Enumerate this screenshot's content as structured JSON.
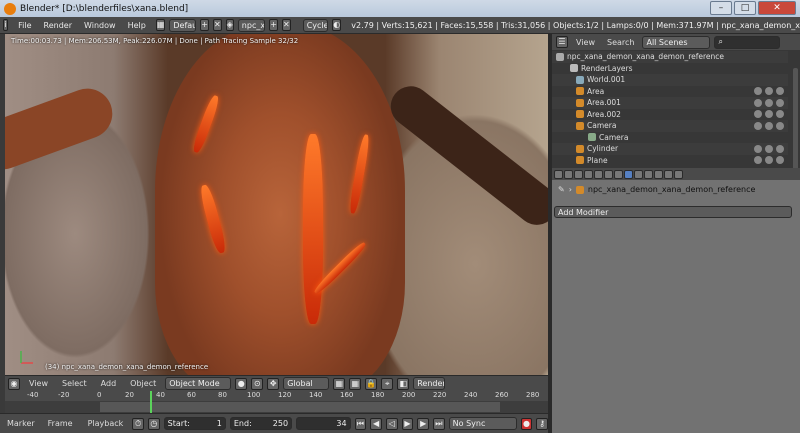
{
  "window": {
    "title": "Blender* [D:\\blenderfiles\\xana.blend]",
    "min": "–",
    "max": "□",
    "close": "✕"
  },
  "info": {
    "menus": [
      "File",
      "Render",
      "Window",
      "Help"
    ],
    "screen_layout": "Default",
    "scene": "npc_xana_demon_x...",
    "engine": "Cycles Render",
    "stats": "v2.79 | Verts:15,621 | Faces:15,558 | Tris:31,056 | Objects:1/2 | Lamps:0/0 | Mem:371.97M | npc_xana_demon_x"
  },
  "viewport": {
    "render_info": "Time:00:03.73 | Mem:206.53M, Peak:226.07M | Done | Path Tracing Sample 32/32",
    "object_label": "(34) npc_xana_demon_xana_demon_reference",
    "menus": [
      "View",
      "Select",
      "Add",
      "Object"
    ],
    "mode": "Object Mode",
    "orientation": "Global",
    "render_layer": "RenderLay"
  },
  "timeline": {
    "ticks": [
      "-40",
      "-20",
      "0",
      "20",
      "40",
      "60",
      "80",
      "100",
      "120",
      "140",
      "160",
      "180",
      "200",
      "220",
      "240",
      "260",
      "280"
    ],
    "current_frame": "34",
    "menus": [
      "Marker",
      "Frame",
      "Playback"
    ],
    "start_label": "Start:",
    "start": "1",
    "end_label": "End:",
    "end": "250",
    "sync": "No Sync"
  },
  "outliner": {
    "view": "View",
    "search": "Search",
    "filter": "All Scenes",
    "rows": [
      "npc_xana_demon_xana_demon_reference",
      "RenderLayers",
      "World.001",
      "Area",
      "Area.001",
      "Area.002",
      "Camera",
      "Camera",
      "Cylinder",
      "Plane"
    ]
  },
  "properties": {
    "object": "npc_xana_demon_xana_demon_reference",
    "add_modifier": "Add Modifier"
  }
}
